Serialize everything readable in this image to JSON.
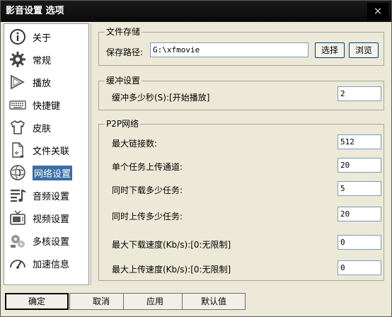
{
  "window": {
    "title": "影音设置 选项",
    "close_glyph": "✕"
  },
  "sidebar": {
    "items": [
      {
        "label": "关于",
        "icon": "info-icon"
      },
      {
        "label": "常规",
        "icon": "gear-icon"
      },
      {
        "label": "播放",
        "icon": "play-icon"
      },
      {
        "label": "快捷键",
        "icon": "keyboard-icon"
      },
      {
        "label": "皮肤",
        "icon": "shirt-icon"
      },
      {
        "label": "文件关联",
        "icon": "file-link-icon"
      },
      {
        "label": "网络设置",
        "icon": "network-icon",
        "selected": true
      },
      {
        "label": "音频设置",
        "icon": "audio-icon"
      },
      {
        "label": "视频设置",
        "icon": "tv-icon"
      },
      {
        "label": "多核设置",
        "icon": "multicore-icon"
      },
      {
        "label": "加速信息",
        "icon": "speedometer-icon"
      }
    ]
  },
  "file_storage": {
    "title": "文件存储",
    "path_label": "保存路径:",
    "path_value": "G:\\xfmovie",
    "select_button": "选择",
    "browse_button": "浏览"
  },
  "buffer": {
    "title": "缓冲设置",
    "seconds_label": "缓冲多少秒(S):[开始播放]",
    "seconds_value": "2"
  },
  "p2p": {
    "title": "P2P网络",
    "max_connections_label": "最大链接数:",
    "max_connections_value": "512",
    "upload_channels_label": "单个任务上传通道:",
    "upload_channels_value": "20",
    "concurrent_downloads_label": "同时下载多少任务:",
    "concurrent_downloads_value": "5",
    "concurrent_uploads_label": "同时上传多少任务:",
    "concurrent_uploads_value": "20",
    "max_download_speed_label": "最大下载速度(Kb/s):[0:无限制]",
    "max_download_speed_value": "0",
    "max_upload_speed_label": "最大上传速度(Kb/s):[0:无限制]",
    "max_upload_speed_value": "0"
  },
  "footer": {
    "ok": "确定",
    "cancel": "取消",
    "apply": "应用",
    "defaults": "默认值"
  }
}
